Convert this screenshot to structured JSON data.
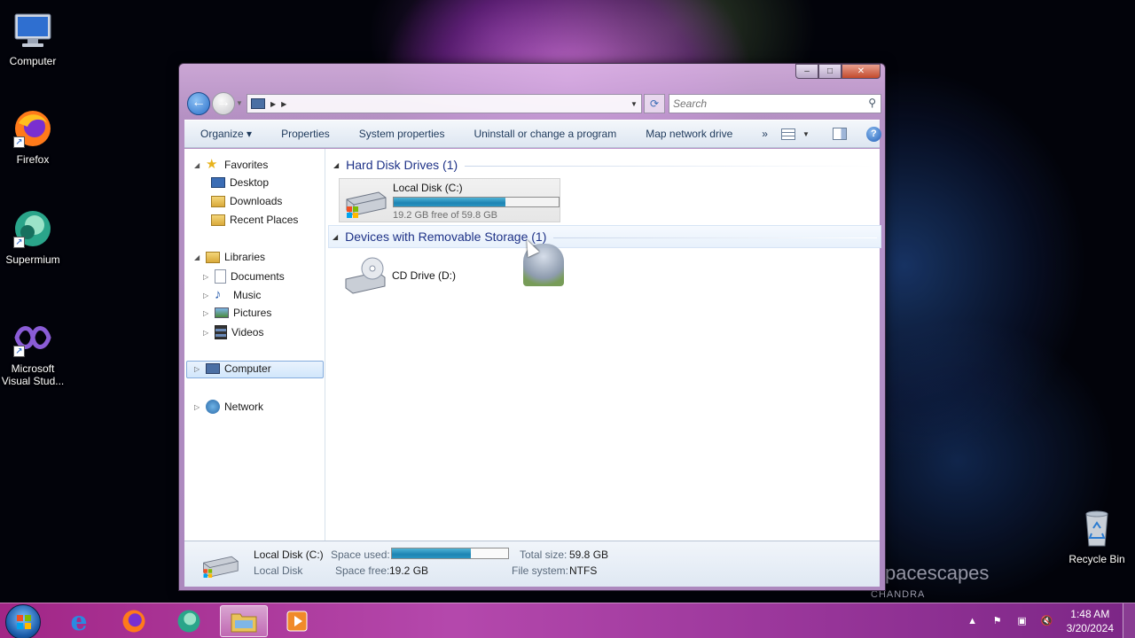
{
  "desktop": {
    "icons": [
      {
        "label": "Computer"
      },
      {
        "label": "Firefox"
      },
      {
        "label": "Supermium"
      },
      {
        "label": "Microsoft Visual Stud..."
      },
      {
        "label": "Recycle Bin"
      }
    ],
    "wallpaper_text": "pacescapes",
    "wallpaper_subtext": "CHANDRA"
  },
  "window": {
    "buttons": {
      "minimize": "–",
      "maximize": "□",
      "close": "✕"
    },
    "search_placeholder": "Search",
    "toolbar": {
      "organize": "Organize",
      "properties": "Properties",
      "system_properties": "System properties",
      "uninstall": "Uninstall or change a program",
      "map_network": "Map network drive",
      "more": "»"
    },
    "nav_pane": {
      "favorites": "Favorites",
      "desktop": "Desktop",
      "downloads": "Downloads",
      "recent_places": "Recent Places",
      "libraries": "Libraries",
      "documents": "Documents",
      "music": "Music",
      "pictures": "Pictures",
      "videos": "Videos",
      "computer": "Computer",
      "network": "Network"
    },
    "groups": {
      "hard_disk": "Hard Disk Drives (1)",
      "removable": "Devices with Removable Storage (1)"
    },
    "drives": {
      "c": {
        "name": "Local Disk (C:)",
        "free_text": "19.2 GB free of 59.8 GB",
        "used_fraction": 0.68
      },
      "d": {
        "name": "CD Drive (D:)"
      }
    },
    "details": {
      "name": "Local Disk (C:)",
      "type": "Local Disk",
      "space_used_label": "Space used:",
      "space_free_label": "Space free:",
      "space_free_value": "19.2 GB",
      "total_size_label": "Total size:",
      "total_size_value": "59.8 GB",
      "file_system_label": "File system:",
      "file_system_value": "NTFS",
      "used_fraction": 0.68
    }
  },
  "taskbar": {
    "clock_time": "1:48 AM",
    "clock_date": "3/20/2024"
  },
  "colors": {
    "accent_bar": "#1e84b3",
    "group_header": "#1e3287",
    "taskbar": "#c050b8"
  }
}
